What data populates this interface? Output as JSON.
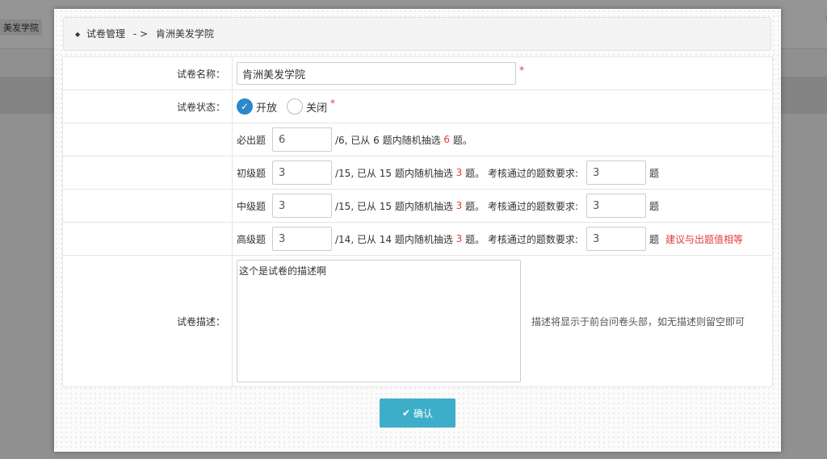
{
  "background": {
    "tab_label": "美发学院"
  },
  "modal": {
    "close_glyph": "✕",
    "breadcrumb": {
      "part1": "试卷管理",
      "separator": "- >",
      "part2": "肯洲美发学院"
    },
    "fields": {
      "name": {
        "label": "试卷名称：",
        "value": "肯洲美发学院",
        "required_mark": "*"
      },
      "status": {
        "label": "试卷状态：",
        "option_open": "开放",
        "option_closed": "关闭",
        "selected": "开放",
        "required_mark": "*"
      },
      "questions": [
        {
          "label": "必出题",
          "value": "6",
          "text_pre": "/6, 已从 6 题内随机抽选 ",
          "count": "6",
          "text_post": " 题。"
        },
        {
          "label": "初级题",
          "value": "3",
          "text_pre": "/15, 已从 15 题内随机抽选 ",
          "count": "3",
          "text_post": " 题。 考核通过的题数要求:",
          "pass_value": "3",
          "unit": "题"
        },
        {
          "label": "中级题",
          "value": "3",
          "text_pre": "/15, 已从 15 题内随机抽选 ",
          "count": "3",
          "text_post": " 题。 考核通过的题数要求:",
          "pass_value": "3",
          "unit": "题"
        },
        {
          "label": "高级题",
          "value": "3",
          "text_pre": "/14, 已从 14 题内随机抽选 ",
          "count": "3",
          "text_post": " 题。 考核通过的题数要求:",
          "pass_value": "3",
          "unit": "题",
          "note": "建议与出题值相等"
        }
      ],
      "description": {
        "label": "试卷描述：",
        "value": "这个是试卷的描述啊",
        "hint": "描述将显示于前台问卷头部，如无描述则留空即可"
      }
    },
    "confirm": {
      "icon": "✔",
      "label": "确认"
    }
  },
  "colors": {
    "accent": "#3daec9",
    "radio_on": "#2b88c9",
    "required": "#e23b3b"
  }
}
